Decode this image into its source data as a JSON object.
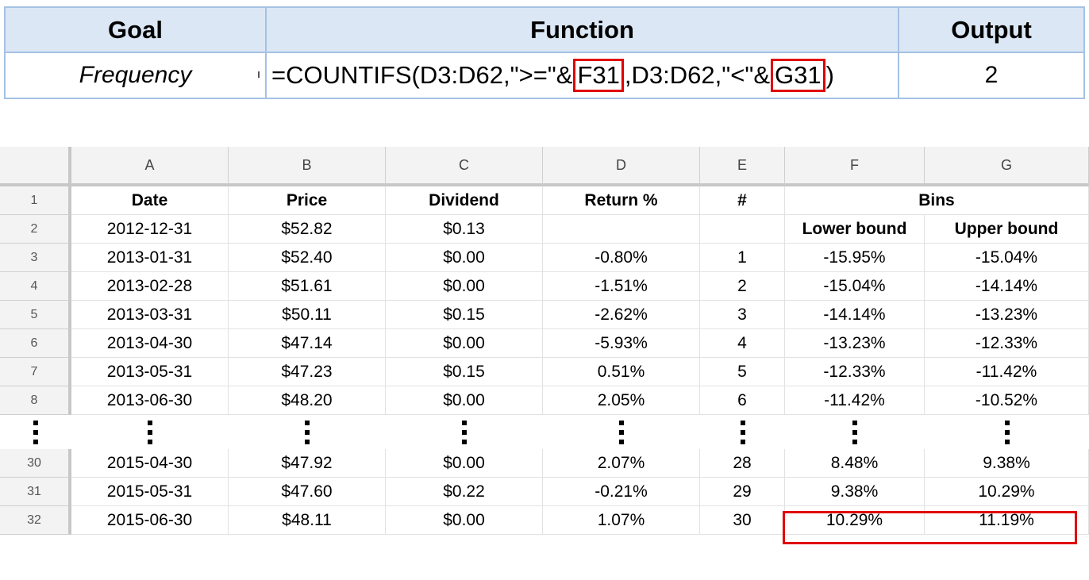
{
  "formula_table": {
    "headers": [
      "Goal",
      "Function",
      "Output"
    ],
    "goal": "Frequency",
    "formula_parts": [
      "=COUNTIFS(D3:D62,\">=\"&",
      "F31",
      ",D3:D62,\"<\"&",
      "G31",
      ")"
    ],
    "output": "2"
  },
  "sheet": {
    "column_headers": [
      "A",
      "B",
      "C",
      "D",
      "E",
      "F",
      "G"
    ],
    "header_row": {
      "row_number": "1",
      "date": "Date",
      "price": "Price",
      "dividend": "Dividend",
      "return": "Return %",
      "index": "#",
      "bins": "Bins"
    },
    "subheader_row": {
      "row_number": "2",
      "date": "2012-12-31",
      "price": "$52.82",
      "dividend": "$0.13",
      "return": "",
      "index": "",
      "lower": "Lower bound",
      "upper": "Upper bound"
    },
    "rows": [
      [
        "3",
        "2013-01-31",
        "$52.40",
        "$0.00",
        "-0.80%",
        "1",
        "-15.95%",
        "-15.04%"
      ],
      [
        "4",
        "2013-02-28",
        "$51.61",
        "$0.00",
        "-1.51%",
        "2",
        "-15.04%",
        "-14.14%"
      ],
      [
        "5",
        "2013-03-31",
        "$50.11",
        "$0.15",
        "-2.62%",
        "3",
        "-14.14%",
        "-13.23%"
      ],
      [
        "6",
        "2013-04-30",
        "$47.14",
        "$0.00",
        "-5.93%",
        "4",
        "-13.23%",
        "-12.33%"
      ],
      [
        "7",
        "2013-05-31",
        "$47.23",
        "$0.15",
        "0.51%",
        "5",
        "-12.33%",
        "-11.42%"
      ],
      [
        "8",
        "2013-06-30",
        "$48.20",
        "$0.00",
        "2.05%",
        "6",
        "-11.42%",
        "-10.52%"
      ]
    ],
    "rows_after_gap": [
      [
        "30",
        "2015-04-30",
        "$47.92",
        "$0.00",
        "2.07%",
        "28",
        "8.48%",
        "9.38%"
      ],
      [
        "31",
        "2015-05-31",
        "$47.60",
        "$0.22",
        "-0.21%",
        "29",
        "9.38%",
        "10.29%"
      ],
      [
        "32",
        "2015-06-30",
        "$48.11",
        "$0.00",
        "1.07%",
        "30",
        "10.29%",
        "11.19%"
      ]
    ],
    "highlight_color": "#e00000"
  }
}
